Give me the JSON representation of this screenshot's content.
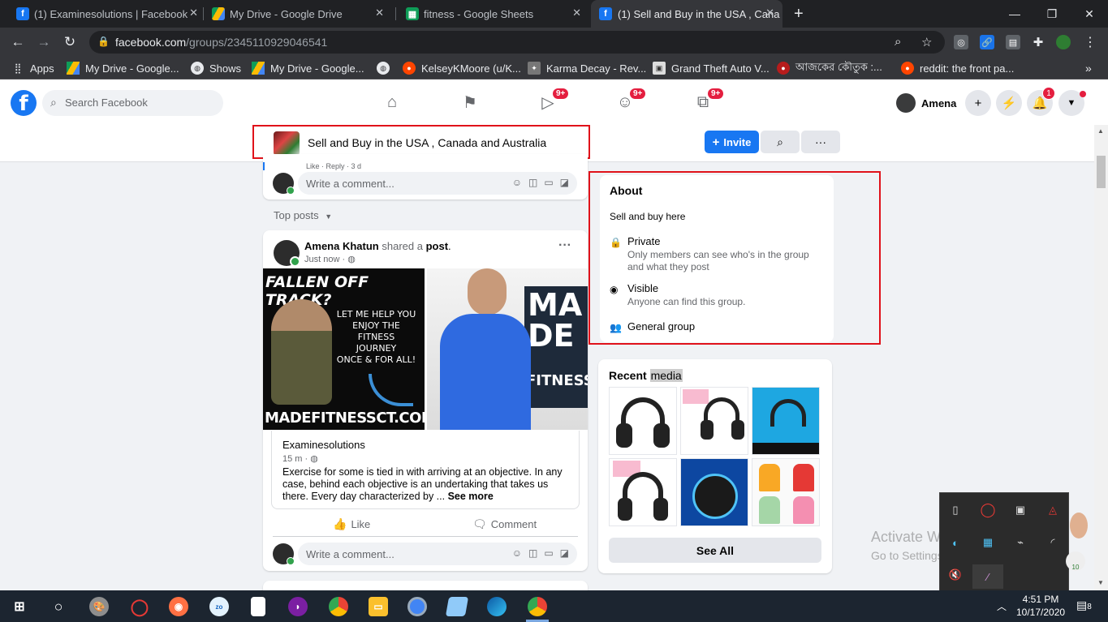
{
  "browser": {
    "tabs": [
      {
        "title": "(1) Examinesolutions | Facebook",
        "icon": "facebook-icon",
        "color": "#1877f2"
      },
      {
        "title": "My Drive - Google Drive",
        "icon": "google-drive-icon",
        "color": "#fbbc04"
      },
      {
        "title": "fitness - Google Sheets",
        "icon": "google-sheets-icon",
        "color": "#0f9d58"
      },
      {
        "title": "(1) Sell and Buy in the USA , Cana",
        "icon": "facebook-icon",
        "color": "#1877f2",
        "active": true
      }
    ],
    "url_host": "facebook.com",
    "url_path": "/groups/2345110929046541",
    "bookmarks": [
      {
        "label": "Apps",
        "icon": "apps-grid-icon"
      },
      {
        "label": "My Drive - Google...",
        "icon": "google-drive-icon"
      },
      {
        "label": "Shows",
        "icon": "globe-icon"
      },
      {
        "label": "My Drive - Google...",
        "icon": "google-drive-icon"
      },
      {
        "label": "",
        "icon": "globe-icon"
      },
      {
        "label": "KelseyKMoore (u/K...",
        "icon": "reddit-icon"
      },
      {
        "label": "Karma Decay - Rev...",
        "icon": "karma-decay-icon"
      },
      {
        "label": "Grand Theft Auto V...",
        "icon": "gta-icon"
      },
      {
        "label": "আজকের কৌতুক :...",
        "icon": "site-icon"
      },
      {
        "label": "reddit: the front pa...",
        "icon": "reddit-icon"
      }
    ]
  },
  "fb": {
    "search_placeholder": "Search Facebook",
    "badges": {
      "video": "9+",
      "groups": "9+",
      "gaming": "9+"
    },
    "profile_name": "Amena",
    "notifications_count": "1"
  },
  "group": {
    "title": "Sell and Buy in the USA , Canada and Australia",
    "invite_label": "Invite"
  },
  "feed": {
    "prev_comment_meta": "Like · Reply · 3 d",
    "comment_placeholder": "Write a comment...",
    "sort_label": "Top posts",
    "post": {
      "author": "Amena Khatun",
      "shared_text": "shared a",
      "shared_link": "post",
      "time": "Just now ·",
      "image_left": {
        "headline": "FALLEN OFF TRACK?",
        "lines": [
          "LET ME HELP YOU",
          "ENJOY THE",
          "FITNESS",
          "JOURNEY",
          "ONCE & FOR ALL!"
        ],
        "footer": "MADEFITNESSCT.COM"
      },
      "image_right": {
        "brand_lines": [
          "MA",
          "DE",
          "FITNESS"
        ]
      },
      "shared_source": "Examinesolutions",
      "shared_time": "15 m ·",
      "shared_body": "Exercise for some is tied in with arriving at an objective. In any case, behind each objective is an undertaking that takes us there. Every day characterized by ...",
      "see_more": "See more",
      "like_label": "Like",
      "comment_label": "Comment"
    }
  },
  "about": {
    "heading": "About",
    "description": "Sell and buy here",
    "privacy_title": "Private",
    "privacy_desc": "Only members can see who's in the group and what they post",
    "visibility_title": "Visible",
    "visibility_desc": "Anyone can find this group.",
    "type_title": "General group"
  },
  "media": {
    "heading_prefix": "Recent",
    "heading_highlight": "media",
    "see_all": "See All"
  },
  "watermark": {
    "title": "Activate Windows",
    "subtitle": "Go to Settings to activate Windows."
  },
  "taskbar": {
    "time": "4:51 PM",
    "date": "10/17/2020",
    "notification_count": "8"
  },
  "colors": {
    "fb_blue": "#1877f2",
    "highlight_red": "#e0121a",
    "badge_red": "#e41e3f"
  }
}
